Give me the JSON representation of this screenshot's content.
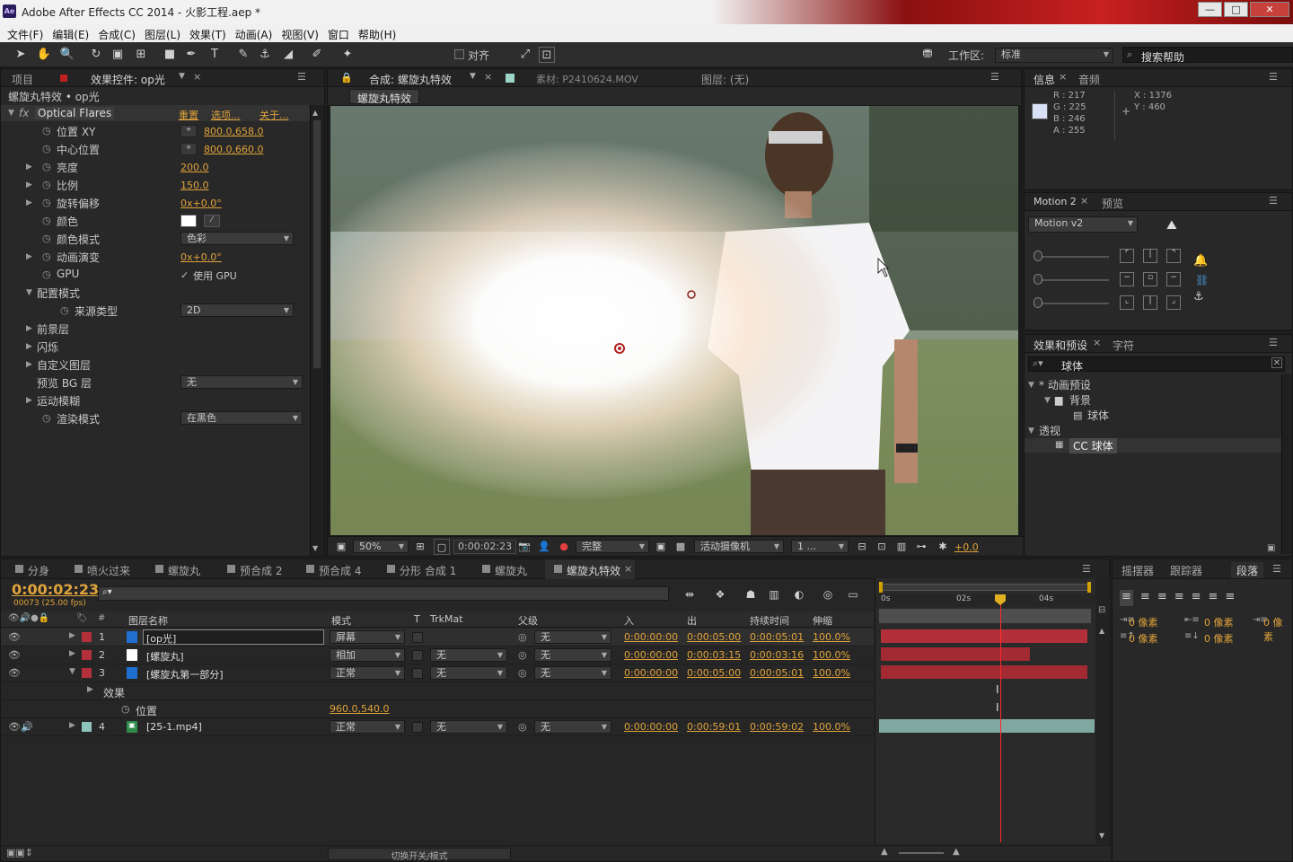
{
  "window": {
    "title": "Adobe After Effects CC 2014 - 火影工程.aep *",
    "logo": "Ae",
    "min": "—",
    "max": "□",
    "close": "✕"
  },
  "menu": [
    "文件(F)",
    "编辑(E)",
    "合成(C)",
    "图层(L)",
    "效果(T)",
    "动画(A)",
    "视图(V)",
    "窗口",
    "帮助(H)"
  ],
  "toolbar": {
    "align_label": "对齐",
    "workspace_label": "工作区:",
    "workspace_value": "标准",
    "search_placeholder": "搜索帮助"
  },
  "effect_panel": {
    "tab_project": "项目",
    "tab_effects": "效果控件: op光",
    "layer_path": "螺旋丸特效 • op光",
    "effect_name": "Optical Flares",
    "links": [
      "重置",
      "选项...",
      "关于..."
    ],
    "props": [
      {
        "label": "位置 XY",
        "value": "800.0,658.0"
      },
      {
        "label": "中心位置",
        "value": "800.0,660.0"
      },
      {
        "label": "亮度",
        "value": "200.0"
      },
      {
        "label": "比例",
        "value": "150.0"
      },
      {
        "label": "旋转偏移",
        "value": "0x+0.0°"
      },
      {
        "label": "颜色",
        "value": ""
      },
      {
        "label": "颜色模式",
        "value": "色彩"
      },
      {
        "label": "动画演变",
        "value": "0x+0.0°"
      },
      {
        "label": "GPU",
        "value": "使用 GPU"
      },
      {
        "label": "配置模式",
        "value": ""
      },
      {
        "label": "来源类型",
        "value": "2D"
      },
      {
        "label": "前景层",
        "value": ""
      },
      {
        "label": "闪烁",
        "value": ""
      },
      {
        "label": "自定义图层",
        "value": ""
      },
      {
        "label": "预览 BG 层",
        "value": "无"
      },
      {
        "label": "运动模糊",
        "value": ""
      },
      {
        "label": "渲染模式",
        "value": "在黑色"
      }
    ]
  },
  "comp_panel": {
    "tab_comp": "合成: 螺旋丸特效",
    "tab_footage": "素材: P2410624.MOV",
    "tab_layer": "图层: (无)",
    "comp_chip": "螺旋丸特效",
    "zoom": "50%",
    "timecode": "0:00:02:23",
    "quality": "完整",
    "camera": "活动摄像机",
    "views": "1 ...",
    "exposure": "+0.0"
  },
  "info_panel": {
    "tab_info": "信息",
    "tab_audio": "音频",
    "r": "R : 217",
    "g": "G : 225",
    "b": "B : 246",
    "a": "A : 255",
    "x": "X : 1376",
    "y": "Y : 460"
  },
  "motion_panel": {
    "tab": "Motion 2",
    "tab_preview": "预览",
    "dropdown": "Motion v2"
  },
  "effects_presets": {
    "tab": "效果和预设",
    "tab_char": "字符",
    "search": "球体",
    "tree": [
      {
        "label": "* 动画预设",
        "level": 0
      },
      {
        "label": "背景",
        "level": 1
      },
      {
        "label": "球体",
        "level": 2
      },
      {
        "label": "透视",
        "level": 0
      },
      {
        "label": "CC 球体",
        "level": 1
      }
    ]
  },
  "timeline": {
    "tabs": [
      "分身",
      "喷火过来",
      "螺旋丸",
      "预合成 2",
      "预合成 4",
      "分形 合成 1",
      "螺旋丸",
      "螺旋丸特效"
    ],
    "current_time": "0:00:02:23",
    "frame_info": "00073 (25.00 fps)",
    "columns": {
      "name": "图层名称",
      "mode": "模式",
      "t": "T",
      "trkmat": "TrkMat",
      "parent": "父级",
      "in": "入",
      "out": "出",
      "duration": "持续时间",
      "stretch": "伸缩"
    },
    "layers": [
      {
        "num": "1",
        "name": "[op光]",
        "mode": "屏幕",
        "trkmat": "",
        "parent": "无",
        "in": "0:00:00:00",
        "out": "0:00:05:00",
        "dur": "0:00:05:01",
        "stretch": "100.0%"
      },
      {
        "num": "2",
        "name": "[螺旋丸]",
        "mode": "相加",
        "trkmat": "无",
        "parent": "无",
        "in": "0:00:00:00",
        "out": "0:00:03:15",
        "dur": "0:00:03:16",
        "stretch": "100.0%"
      },
      {
        "num": "3",
        "name": "[螺旋丸第一部分]",
        "mode": "正常",
        "trkmat": "无",
        "parent": "无",
        "in": "0:00:00:00",
        "out": "0:00:05:00",
        "dur": "0:00:05:01",
        "stretch": "100.0%"
      },
      {
        "num": "4",
        "name": "[25-1.mp4]",
        "mode": "正常",
        "trkmat": "无",
        "parent": "无",
        "in": "0:00:00:00",
        "out": "0:00:59:01",
        "dur": "0:00:59:02",
        "stretch": "100.0%"
      }
    ],
    "effects_label": "效果",
    "position_label": "位置",
    "position_value": "960.0,540.0",
    "ruler": [
      "0s",
      "02s",
      "04s"
    ],
    "toggle_label": "切换开关/模式"
  },
  "paragraph_panel": {
    "tabs": [
      "摇摆器",
      "跟踪器",
      "段落"
    ],
    "fields": [
      "0 像素",
      "0 像素",
      "0 像素",
      "0 像素",
      "0 像素"
    ]
  },
  "colors": {
    "accent": "#e0a33c",
    "layer_red": "#b3303a",
    "layer_teal": "#7fa9a0",
    "playhead": "#ff2a2a"
  }
}
